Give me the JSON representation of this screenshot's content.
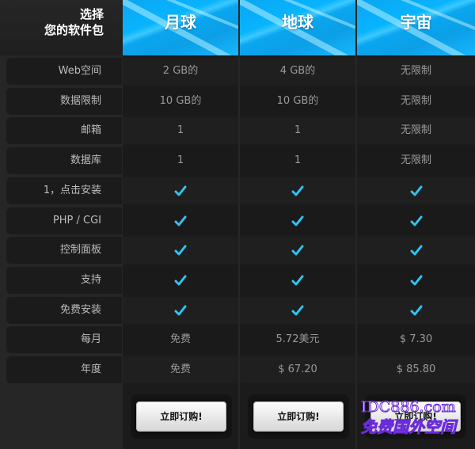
{
  "header": {
    "corner_line1": "选择",
    "corner_line2": "您的软件包"
  },
  "features": [
    "Web空间",
    "数据限制",
    "邮箱",
    "数据库",
    "1，点击安装",
    "PHP / CGI",
    "控制面板",
    "支持",
    "免费安装",
    "每月",
    "年度"
  ],
  "plans": [
    {
      "name": "月球",
      "values": [
        "2 GB的",
        "10 GB的",
        "1",
        "1",
        "✓",
        "✓",
        "✓",
        "✓",
        "✓",
        "免费",
        "免费"
      ],
      "button": "立即订购!"
    },
    {
      "name": "地球",
      "values": [
        "4 GB的",
        "10 GB的",
        "1",
        "1",
        "✓",
        "✓",
        "✓",
        "✓",
        "✓",
        "5.72美元",
        "$ 67.20"
      ],
      "button": "立即订购!"
    },
    {
      "name": "宇宙",
      "values": [
        "无限制",
        "无限制",
        "无限制",
        "无限制",
        "✓",
        "✓",
        "✓",
        "✓",
        "✓",
        "$ 7.30",
        "$ 85.80"
      ],
      "button": "立即订购!"
    }
  ],
  "watermark": {
    "line1": "IDC886.com",
    "line2": "免费国外空间"
  },
  "colors": {
    "accent": "#0aa6f0",
    "check": "#2fc4f2",
    "background": "#262626"
  }
}
